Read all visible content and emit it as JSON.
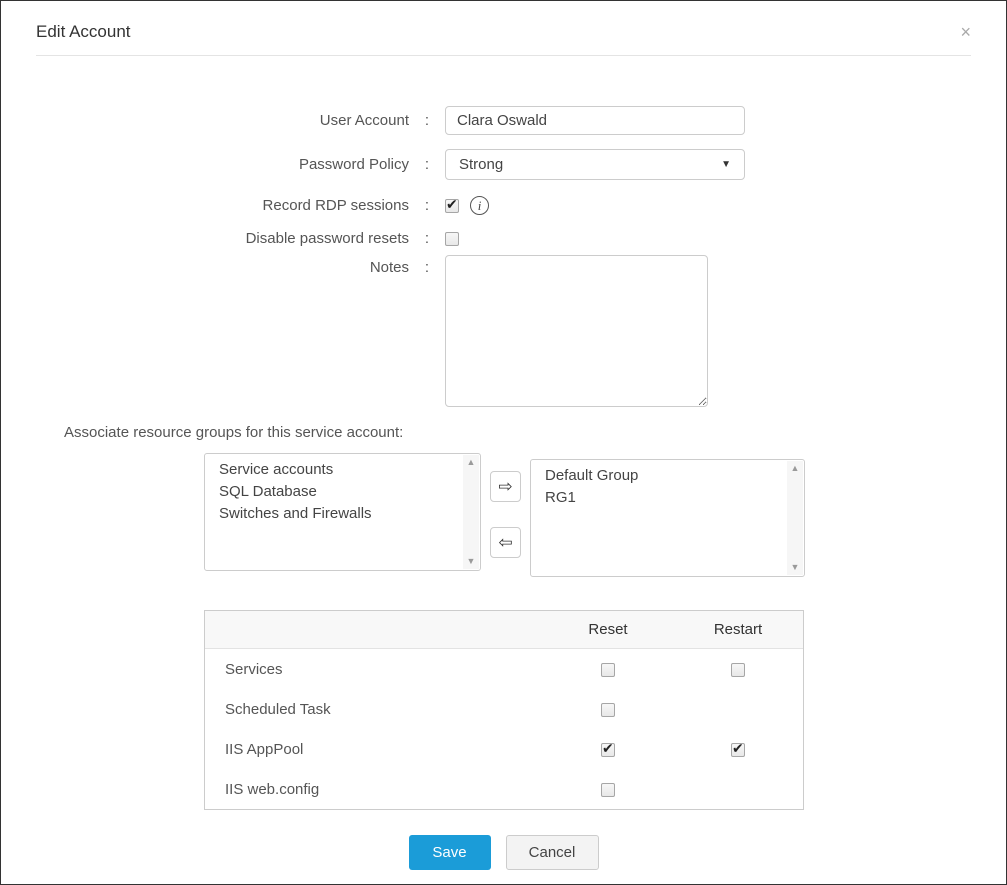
{
  "modal": {
    "title": "Edit Account",
    "close_icon": "×"
  },
  "icons": {
    "scroll_up": "▲",
    "scroll_down": "▼",
    "select_caret": "▼",
    "move_right": "⇨",
    "move_left": "⇦",
    "info": "i",
    "check": "✔"
  },
  "form": {
    "user_account": {
      "label": "User Account",
      "separator": ":",
      "value": "Clara Oswald"
    },
    "password_policy": {
      "label": "Password Policy",
      "separator": ":",
      "value": "Strong"
    },
    "record_rdp": {
      "label": "Record RDP sessions",
      "separator": ":",
      "checked": true
    },
    "disable_resets": {
      "label": "Disable password resets",
      "separator": ":",
      "checked": false
    },
    "notes": {
      "label": "Notes",
      "separator": ":",
      "value": ""
    }
  },
  "resource_groups": {
    "section_label": "Associate resource groups for this service account:",
    "available": [
      "Service accounts",
      "SQL Database",
      "Switches and Firewalls"
    ],
    "assigned": [
      "Default Group",
      "RG1"
    ]
  },
  "actions_table": {
    "columns": [
      "Reset",
      "Restart"
    ],
    "rows": [
      {
        "label": "Services",
        "has_reset": true,
        "reset": false,
        "has_restart": true,
        "restart": false
      },
      {
        "label": "Scheduled Task",
        "has_reset": true,
        "reset": false,
        "has_restart": false,
        "restart": false
      },
      {
        "label": "IIS AppPool",
        "has_reset": true,
        "reset": true,
        "has_restart": true,
        "restart": true
      },
      {
        "label": "IIS web.config",
        "has_reset": true,
        "reset": false,
        "has_restart": false,
        "restart": false
      }
    ]
  },
  "footer": {
    "save_label": "Save",
    "cancel_label": "Cancel"
  },
  "colors": {
    "accent": "#1b9cd8",
    "table_header_bg": "#f8f8f8"
  }
}
